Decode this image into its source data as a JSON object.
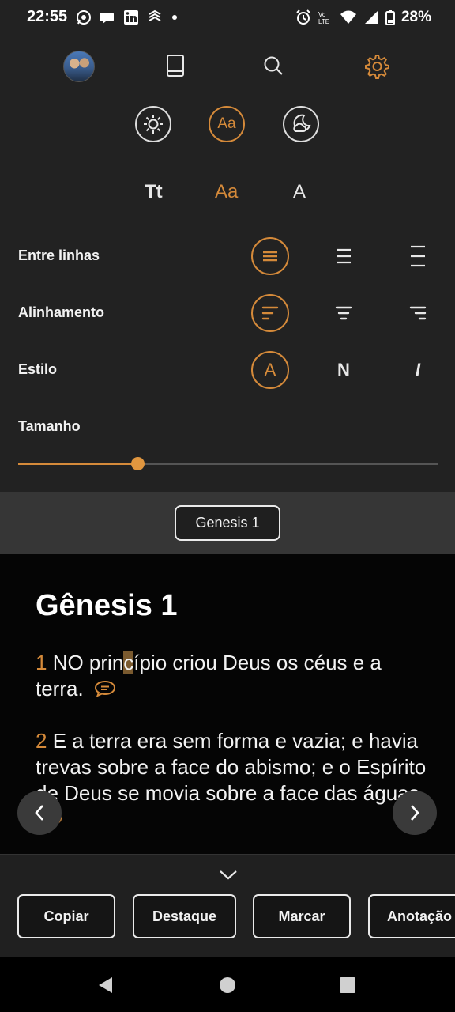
{
  "status_bar": {
    "time": "22:55",
    "battery": "28%",
    "left_icons": [
      "whatsapp-icon",
      "chat-bubble-icon",
      "linkedin-icon",
      "app-icon",
      "dot-icon"
    ],
    "right_icons": [
      "alarm-icon",
      "volte-icon",
      "wifi-icon",
      "signal-icon",
      "battery-icon"
    ]
  },
  "toolbar": {
    "icons": [
      "avatar",
      "book-icon",
      "search-icon",
      "gear-icon"
    ],
    "accent_color": "#d58a3a"
  },
  "theme": {
    "options": [
      "sun-icon",
      "Aa",
      "moon-cloud-icon"
    ],
    "selected": "Aa"
  },
  "font_options": {
    "items": [
      "Tt",
      "Aa",
      "A"
    ],
    "selected": "Aa"
  },
  "settings": {
    "line_spacing_label": "Entre linhas",
    "alignment_label": "Alinhamento",
    "style_label": "Estilo",
    "style_options": [
      "A",
      "N",
      "I"
    ],
    "size_label": "Tamanho",
    "size_fraction": 0.285
  },
  "chapter_selector": {
    "label": "Genesis 1"
  },
  "reading": {
    "title": "Gênesis 1",
    "verses": [
      {
        "num": "1",
        "text_a": "NO prin",
        "text_cursor": "c",
        "text_b": "ípio criou Deus os céus e a terra."
      },
      {
        "num": "2",
        "text": "E a terra era sem forma e vazia; e havia trevas sobre a face do abismo; e o Espírito de Deus se movia sobre a face das águas."
      }
    ]
  },
  "actions": {
    "copy": "Copiar",
    "highlight": "Destaque",
    "mark": "Marcar",
    "note": "Anotação"
  }
}
